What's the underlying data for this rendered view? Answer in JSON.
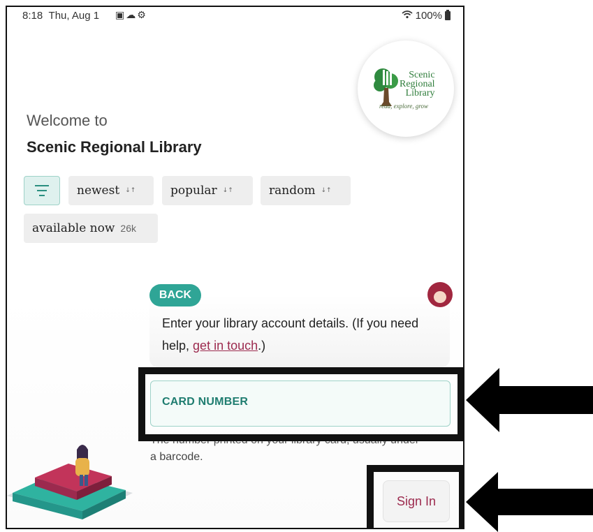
{
  "status_bar": {
    "time": "8:18",
    "date": "Thu, Aug 1",
    "battery": "100%",
    "icons": [
      "image-icon",
      "cloud-icon",
      "settings-icon",
      "wifi-icon",
      "battery-icon"
    ]
  },
  "logo": {
    "line1": "Scenic",
    "line2": "Regional",
    "line3": "Library",
    "tagline": "read, explore, grow"
  },
  "header": {
    "welcome": "Welcome to",
    "library_name": "Scenic Regional Library"
  },
  "filters": {
    "chips": [
      {
        "label": "newest",
        "sort_icon": "↓↑"
      },
      {
        "label": "popular",
        "sort_icon": "↓↑"
      },
      {
        "label": "random",
        "sort_icon": "↓↑"
      }
    ],
    "available": {
      "label": "available now",
      "count": "26k"
    }
  },
  "login": {
    "back_label": "BACK",
    "message_prefix": "Enter your library account details. (If you need help, ",
    "message_link": "get in touch",
    "message_suffix": ".)",
    "card_label": "CARD NUMBER",
    "help_line1": "The number printed on your library card, usually under",
    "help_line2": "a barcode.",
    "sign_in_label": "Sign In"
  },
  "colors": {
    "accent_teal": "#2fa596",
    "link_maroon": "#9c2a4e",
    "brand_green": "#2f7d3b"
  }
}
